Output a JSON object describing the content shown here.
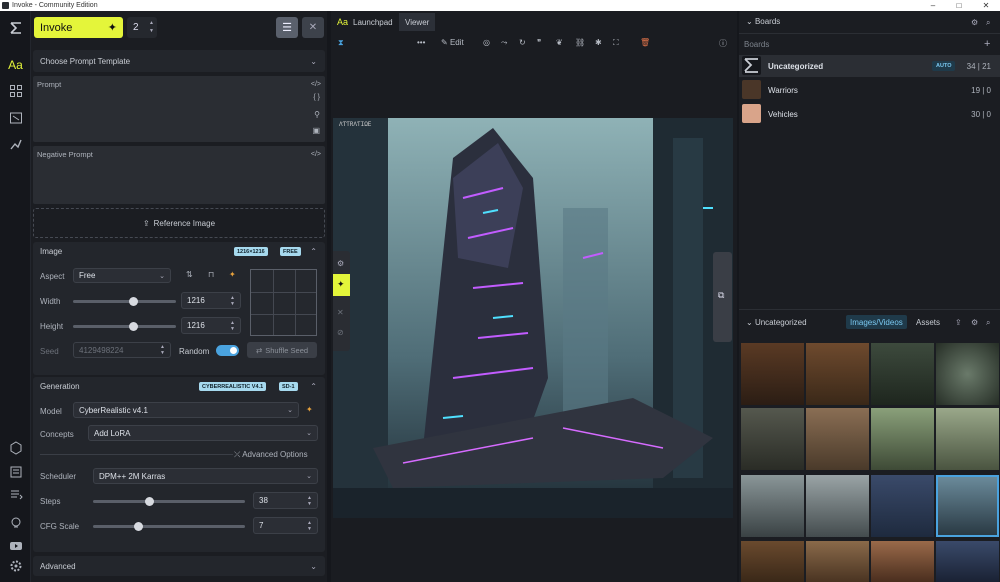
{
  "window": {
    "title": "Invoke - Community Edition",
    "minimize": "–",
    "maximize": "□",
    "close": "✕"
  },
  "left": {
    "invoke_label": "Invoke",
    "queue_count": "2",
    "prompt_template": "Choose Prompt Template",
    "prompt_label": "Prompt",
    "negative_prompt_label": "Negative Prompt",
    "reference_image": "Reference Image",
    "image_section": {
      "title": "Image",
      "size_badge": "1216×1216",
      "free_badge": "FREE",
      "aspect_label": "Aspect",
      "aspect_value": "Free",
      "width_label": "Width",
      "width_value": "1216",
      "width_slider": 0.59,
      "height_label": "Height",
      "height_value": "1216",
      "height_slider": 0.59,
      "seed_label": "Seed",
      "seed_value": "4129498224",
      "random_label": "Random",
      "shuffle_label": "Shuffle Seed"
    },
    "generation": {
      "title": "Generation",
      "model_badge": "CYBERREALISTIC V4.1",
      "sd_badge": "SD-1",
      "model_label": "Model",
      "model_value": "CyberRealistic v4.1",
      "concepts_label": "Concepts",
      "concepts_value": "Add LoRA",
      "advanced_options": "Advanced Options",
      "scheduler_label": "Scheduler",
      "scheduler_value": "DPM++ 2M Karras",
      "steps_label": "Steps",
      "steps_value": "38",
      "steps_slider": 0.37,
      "cfg_label": "CFG Scale",
      "cfg_value": "7",
      "cfg_slider": 0.3
    },
    "advanced": "Advanced"
  },
  "center": {
    "tab_launchpad": "Launchpad",
    "tab_launchpad_icon": "Aa",
    "tab_viewer": "Viewer",
    "edit_label": "Edit",
    "image_caption": "ΛƬƬRΛƬIΩE"
  },
  "right": {
    "boards_title": "Boards",
    "boards_sub": "Boards",
    "boards": [
      {
        "name": "Uncategorized",
        "badge": "AUTO",
        "count": "34 | 21"
      },
      {
        "name": "Warriors",
        "count": "19 | 0"
      },
      {
        "name": "Vehicles",
        "count": "30 | 0"
      }
    ],
    "gallery_title": "Uncategorized",
    "tab_images": "Images/Videos",
    "tab_assets": "Assets"
  },
  "colors": {
    "accent": "#e4f53a",
    "badge": "#a6d9ee",
    "toggle": "#4aa3df"
  }
}
